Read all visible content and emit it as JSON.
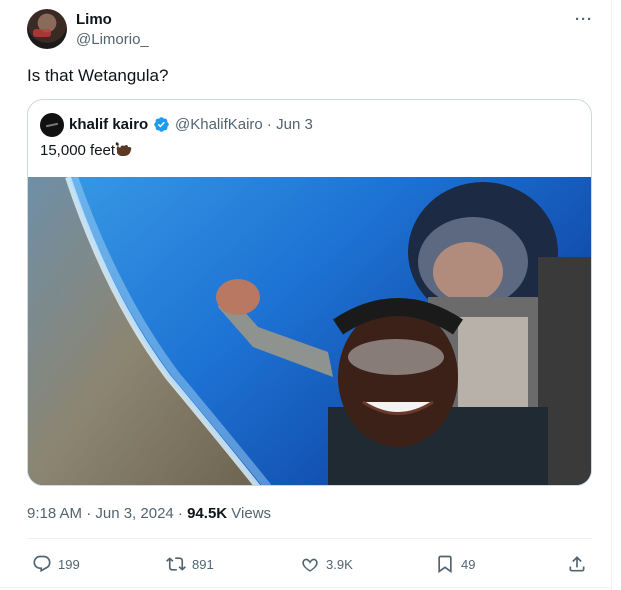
{
  "author": {
    "display_name": "Limo",
    "handle": "@Limorio_"
  },
  "tweet": {
    "text": "Is that Wetangula?"
  },
  "quoted_tweet": {
    "display_name": "khalif kairo",
    "handle_date": "@KhalifKairo · Jun 3",
    "text": "15,000 feet",
    "emoji": "call-me-hand-dark-skin"
  },
  "meta": {
    "timestamp": "9:18 AM · Jun 3, 2024 · ",
    "views_count": "94.5K",
    "views_label": " Views"
  },
  "actions": {
    "replies": "199",
    "reposts": "891",
    "likes": "3.9K",
    "bookmarks": "49"
  },
  "colors": {
    "text": "#0f1419",
    "secondary": "#536471",
    "verified": "#1d9bf0",
    "sky": "#1b6fd0"
  }
}
